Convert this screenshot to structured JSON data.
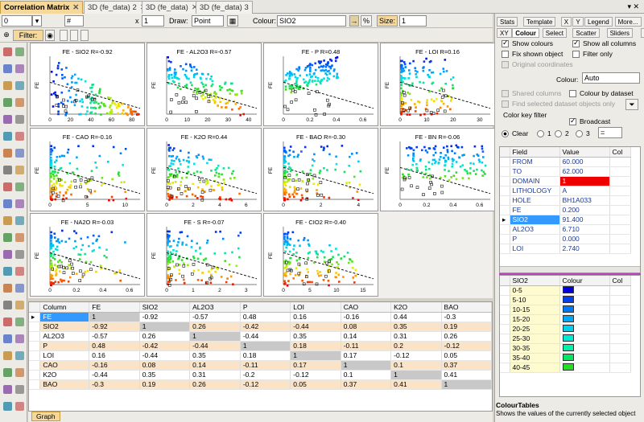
{
  "tabs": [
    {
      "label": "Correlation Matrix",
      "active": true
    },
    {
      "label": "3D (fe_data) 2"
    },
    {
      "label": "3D (fe_data)"
    },
    {
      "label": "3D (fe_data) 3"
    }
  ],
  "toolbar": {
    "value0": "0",
    "x_label": "x",
    "x_value": "1",
    "draw_label": "Draw:",
    "draw_value": "Point",
    "colour_label": "Colour:",
    "colour_value": "SIO2",
    "percent": "%",
    "size_label": "Size:",
    "size_value": "1",
    "filter_label": "Filter:"
  },
  "plots": [
    {
      "title": "FE - SIO2 R=-0.92",
      "ylabel": "FE",
      "xticks": [
        "0",
        "20",
        "40",
        "60",
        "80"
      ],
      "shape": "tri-neg"
    },
    {
      "title": "FE - AL2O3 R=-0.57",
      "ylabel": "FE",
      "xticks": [
        "0",
        "10",
        "20",
        "30",
        "40"
      ],
      "shape": "band"
    },
    {
      "title": "FE - P R=0.48",
      "ylabel": "FE",
      "xticks": [
        "0",
        "0.2",
        "0.4",
        "0.6"
      ],
      "shape": "pos"
    },
    {
      "title": "FE - LOI R=0.16",
      "ylabel": "FE",
      "xticks": [
        "0",
        "10",
        "20",
        "30"
      ],
      "shape": "lean"
    },
    {
      "title": "FE - CAO R=-0.16",
      "ylabel": "FE",
      "xticks": [
        "0",
        "5",
        "10"
      ],
      "shape": "l"
    },
    {
      "title": "FE - K2O R=0.44",
      "ylabel": "FE",
      "xticks": [
        "0",
        "2",
        "4",
        "6"
      ],
      "shape": "l2"
    },
    {
      "title": "FE - BAO R=-0.30",
      "ylabel": "FE",
      "xticks": [
        "0",
        "2",
        "4"
      ],
      "shape": "l"
    },
    {
      "title": "FE - BN R=-0.06",
      "ylabel": "FE",
      "xticks": [
        "0",
        "0.2",
        "0.4",
        "0.6"
      ],
      "shape": "flat"
    },
    {
      "title": "FE - NA2O R=-0.03",
      "ylabel": "FE",
      "xticks": [
        "0",
        "0.2",
        "0.4",
        "0.6"
      ],
      "shape": "l"
    },
    {
      "title": "FE - S R=-0.07",
      "ylabel": "FE",
      "xticks": [
        "0",
        "1",
        "2",
        "3"
      ],
      "shape": "l"
    },
    {
      "title": "FE - CIO2 R=-0.40",
      "ylabel": "FE",
      "xticks": [
        "0",
        "5",
        "10",
        "15"
      ],
      "shape": "l2"
    }
  ],
  "matrix": {
    "columns": [
      "Column",
      "FE",
      "SIO2",
      "AL2O3",
      "P",
      "LOI",
      "CAO",
      "K2O",
      "BAO"
    ],
    "rows": [
      {
        "name": "FE",
        "vals": [
          "1",
          "-0.92",
          "-0.57",
          "0.48",
          "0.16",
          "-0.16",
          "0.44",
          "-0.3"
        ]
      },
      {
        "name": "SIO2",
        "vals": [
          "-0.92",
          "1",
          "0.26",
          "-0.42",
          "-0.44",
          "0.08",
          "0.35",
          "0.19"
        ]
      },
      {
        "name": "AL2O3",
        "vals": [
          "-0.57",
          "0.26",
          "1",
          "-0.44",
          "0.35",
          "0.14",
          "0.31",
          "0.26"
        ]
      },
      {
        "name": "P",
        "vals": [
          "0.48",
          "-0.42",
          "-0.44",
          "1",
          "0.18",
          "-0.11",
          "0.2",
          "-0.12"
        ]
      },
      {
        "name": "LOI",
        "vals": [
          "0.16",
          "-0.44",
          "0.35",
          "0.18",
          "1",
          "0.17",
          "-0.12",
          "0.05"
        ]
      },
      {
        "name": "CAO",
        "vals": [
          "-0.16",
          "0.08",
          "0.14",
          "-0.11",
          "0.17",
          "1",
          "0.1",
          "0.37"
        ]
      },
      {
        "name": "K2O",
        "vals": [
          "-0.44",
          "0.35",
          "0.31",
          "-0.2",
          "-0.12",
          "0.1",
          "1",
          "0.41"
        ]
      },
      {
        "name": "BAO",
        "vals": [
          "-0.3",
          "0.19",
          "0.26",
          "-0.12",
          "0.05",
          "0.37",
          "0.41",
          "1"
        ]
      }
    ]
  },
  "bottom_tab": "Graph",
  "right": {
    "tabs_row1": [
      "Stats",
      "Template",
      "X",
      "Y",
      "Legend",
      "More..."
    ],
    "tabs_row2": [
      "XY",
      "Colour",
      "Select",
      "Scatter",
      "Sliders",
      "Density"
    ],
    "show_colours": "Show colours",
    "show_all_columns": "Show all columns",
    "fix_shown_object": "Fix shown object",
    "filter_only": "Filter only",
    "original_coordinates": "Original coordinates",
    "colour_label": "Colour:",
    "colour_value": "Auto",
    "shared_columns": "Shared columns",
    "colour_by_dataset": "Colour by dataset",
    "find_selected": "Find selected dataset objects only",
    "color_key_filter": "Color key filter",
    "broadcast": "Broadcast",
    "clear": "Clear",
    "r1": "1",
    "r2": "2",
    "r3": "3",
    "op": "=",
    "field_header": [
      "Field",
      "Value",
      "Col"
    ],
    "fields": [
      {
        "f": "FROM",
        "v": "60.000"
      },
      {
        "f": "TO",
        "v": "62.000"
      },
      {
        "f": "DOMAIN",
        "v": "1"
      },
      {
        "f": "LITHOLOGY",
        "v": "A"
      },
      {
        "f": "HOLE",
        "v": "BH1A033"
      },
      {
        "f": "FE",
        "v": "0.200"
      },
      {
        "f": "SIO2",
        "v": "91.400"
      },
      {
        "f": "AL2O3",
        "v": "6.710"
      },
      {
        "f": "P",
        "v": "0.000"
      },
      {
        "f": "LOI",
        "v": "2.740"
      }
    ],
    "colour_header": [
      "SIO2",
      "Colour",
      "Col"
    ],
    "colours": [
      {
        "r": "0-5",
        "c": "#0000e0"
      },
      {
        "r": "5-10",
        "c": "#0040f0"
      },
      {
        "r": "10-15",
        "c": "#0078f8"
      },
      {
        "r": "15-20",
        "c": "#00a8f8"
      },
      {
        "r": "20-25",
        "c": "#00d0f0"
      },
      {
        "r": "25-30",
        "c": "#00e8d8"
      },
      {
        "r": "30-35",
        "c": "#00f0a8"
      },
      {
        "r": "35-40",
        "c": "#00e860"
      },
      {
        "r": "40-45",
        "c": "#20e020"
      }
    ],
    "footer_title": "ColourTables",
    "footer_text": "Shows the values of the currently selected object"
  }
}
